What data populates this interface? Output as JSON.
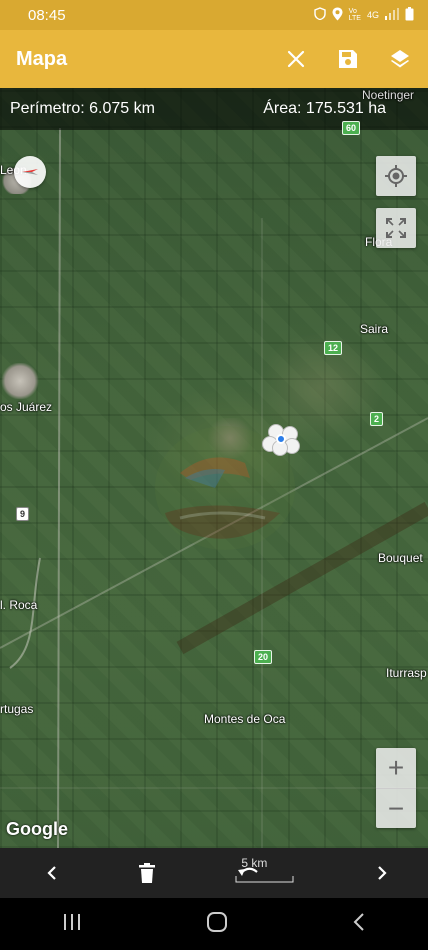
{
  "status_bar": {
    "time": "08:45",
    "icons": [
      "security-icon",
      "location-icon",
      "volte-icon",
      "4g-icon",
      "signal-icon",
      "battery-icon"
    ],
    "volte_label": "Vo\nLTE",
    "network_label": "4G"
  },
  "app_bar": {
    "title": "Mapa",
    "bg_color": "#e8b73d",
    "actions": [
      "close-icon",
      "save-icon",
      "layers-icon"
    ]
  },
  "metrics": {
    "perimeter": "Perímetro: 6.075 km",
    "area": "Área: 175.531 ha"
  },
  "map": {
    "labels": {
      "noetinger": "Noetinger",
      "leones": "Leon",
      "flora": "Flora",
      "saira": "Saira",
      "juarez": "os Juárez",
      "bouquet": "Bouquet",
      "roca": "l. Roca",
      "iturraspe": "Iturrasp",
      "tortugas": "rtugas",
      "montes_de_oca": "Montes de Oca"
    },
    "road_badges": {
      "r60": "60",
      "r12": "12",
      "r2": "2",
      "r9": "9",
      "r20": "20"
    },
    "attribution": "Google"
  },
  "controls": {
    "zoom_in": "+",
    "zoom_out": "−"
  },
  "bottom_bar": {
    "scale_label": "5 km"
  }
}
